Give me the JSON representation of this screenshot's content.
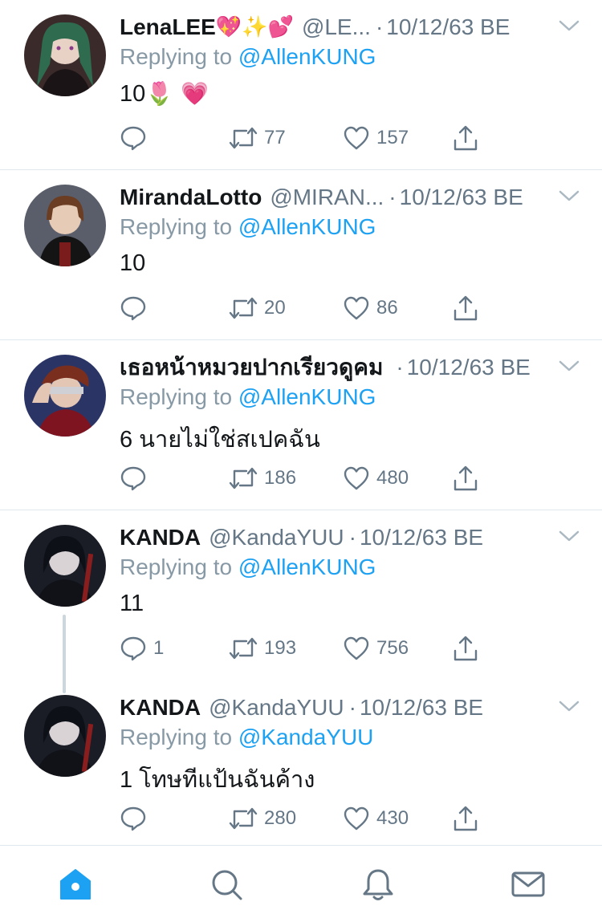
{
  "colors": {
    "accent": "#1da1f2",
    "text": "#14171a",
    "muted": "#657786",
    "divider": "#e1e8ed"
  },
  "tweets": [
    {
      "name": "LenaLEE",
      "name_emoji": "💖✨💕",
      "handle": "@LE...",
      "date": "10/12/63 BE",
      "replying_prefix": "Replying to",
      "replying_to": "@AllenKUNG",
      "text": "10",
      "text_emoji": "🌷 💗",
      "replies": "",
      "retweets": "77",
      "likes": "157"
    },
    {
      "name": "MirandaLotto",
      "handle": "@MIRAN...",
      "date": "10/12/63 BE",
      "replying_prefix": "Replying to",
      "replying_to": "@AllenKUNG",
      "text": "10",
      "replies": "",
      "retweets": "20",
      "likes": "86"
    },
    {
      "name": "เธอหน้าหมวยปากเรียวดูคม",
      "handle": "",
      "date": "10/12/63 BE",
      "replying_prefix": "Replying to",
      "replying_to": "@AllenKUNG",
      "text": "6 นายไม่ใช่สเปคฉัน",
      "replies": "",
      "retweets": "186",
      "likes": "480"
    },
    {
      "name": "KANDA",
      "handle": "@KandaYUU",
      "date": "10/12/63 BE",
      "replying_prefix": "Replying to",
      "replying_to": "@AllenKUNG",
      "text": "11",
      "replies": "1",
      "retweets": "193",
      "likes": "756"
    },
    {
      "name": "KANDA",
      "handle": "@KandaYUU",
      "date": "10/12/63 BE",
      "replying_prefix": "Replying to",
      "replying_to": "@KandaYUU",
      "text": "1 โทษทีแป้นฉันค้าง",
      "replies": "",
      "retweets": "280",
      "likes": "430"
    }
  ],
  "tabbar": {
    "items": [
      {
        "icon": "home-icon",
        "active": true
      },
      {
        "icon": "search-icon",
        "active": false
      },
      {
        "icon": "notifications-icon",
        "active": false
      },
      {
        "icon": "messages-icon",
        "active": false
      }
    ]
  }
}
